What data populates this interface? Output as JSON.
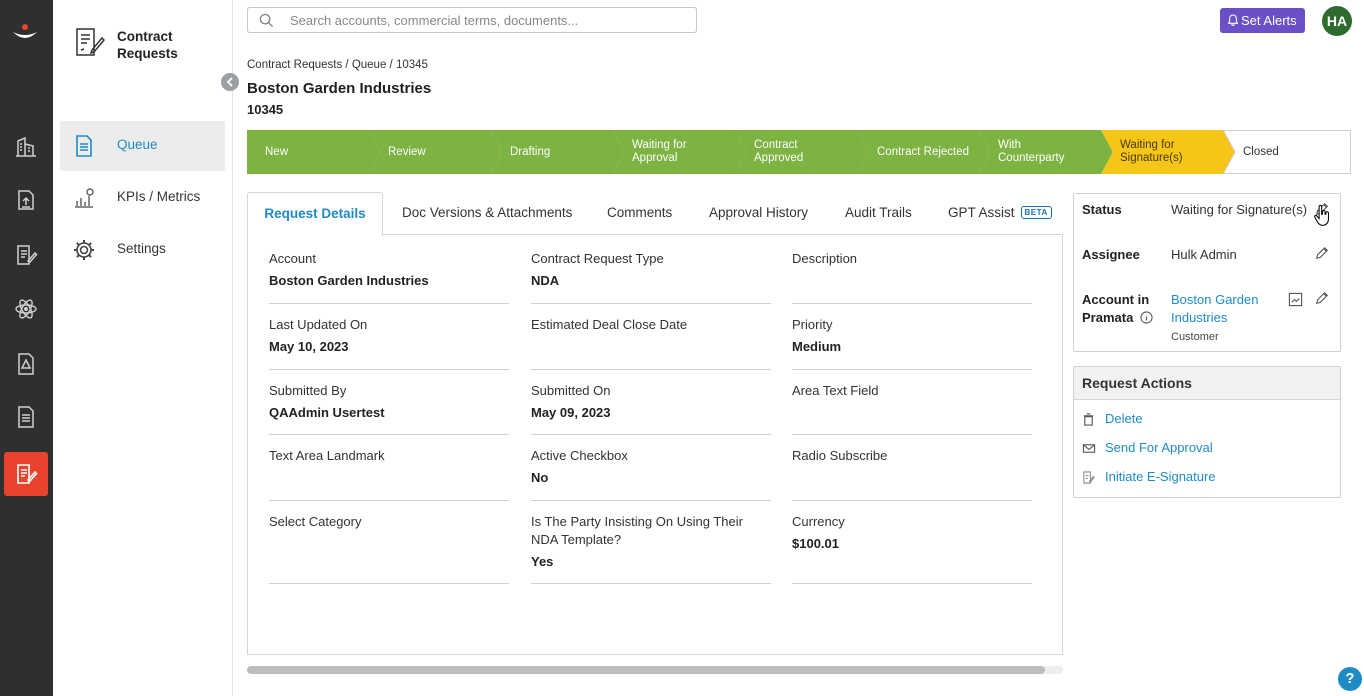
{
  "app": {
    "module_title": "Contract Requests"
  },
  "sidebar": {
    "items": [
      {
        "label": "Queue",
        "icon": "document-list-icon",
        "active": true
      },
      {
        "label": "KPIs / Metrics",
        "icon": "chart-icon",
        "active": false
      },
      {
        "label": "Settings",
        "icon": "gear-icon",
        "active": false
      }
    ]
  },
  "rail": {
    "icons": [
      "logo-icon",
      "building-icon",
      "upload-icon",
      "contract-edit-icon",
      "atom-icon",
      "document-warning-icon",
      "document-icon",
      "contract-requests-icon"
    ]
  },
  "search": {
    "placeholder": "Search accounts, commercial terms, documents..."
  },
  "topbar": {
    "alerts_label": "Set Alerts",
    "avatar_initials": "HA"
  },
  "breadcrumb": "Contract Requests / Queue / 10345",
  "page": {
    "title": "Boston Garden Industries",
    "id": "10345"
  },
  "stepper": {
    "steps": [
      {
        "label": "New",
        "state": "done"
      },
      {
        "label": "Review",
        "state": "done"
      },
      {
        "label": "Drafting",
        "state": "done"
      },
      {
        "label": "Waiting for Approval",
        "state": "done"
      },
      {
        "label": "Contract Approved",
        "state": "done"
      },
      {
        "label": "Contract Rejected",
        "state": "done"
      },
      {
        "label": "With Counterparty",
        "state": "done"
      },
      {
        "label": "Waiting for Signature(s)",
        "state": "current"
      },
      {
        "label": "Closed",
        "state": "pending"
      }
    ]
  },
  "tabs": [
    {
      "label": "Request Details",
      "active": true
    },
    {
      "label": "Doc Versions & Attachments"
    },
    {
      "label": "Comments"
    },
    {
      "label": "Approval History"
    },
    {
      "label": "Audit Trails"
    },
    {
      "label": "GPT Assist",
      "badge": "BETA"
    }
  ],
  "details": [
    {
      "label": "Account",
      "value": "Boston Garden Industries"
    },
    {
      "label": "Contract Request Type",
      "value": "NDA"
    },
    {
      "label": "Description",
      "value": ""
    },
    {
      "label": "Last Updated On",
      "value": "May 10, 2023"
    },
    {
      "label": "Estimated Deal Close Date",
      "value": ""
    },
    {
      "label": "Priority",
      "value": "Medium"
    },
    {
      "label": "Submitted By",
      "value": "QAAdmin Usertest"
    },
    {
      "label": "Submitted On",
      "value": "May 09, 2023"
    },
    {
      "label": "Area Text Field",
      "value": ""
    },
    {
      "label": "Text Area Landmark",
      "value": ""
    },
    {
      "label": "Active Checkbox",
      "value": "No"
    },
    {
      "label": "Radio Subscribe",
      "value": ""
    },
    {
      "label": "Select Category",
      "value": ""
    },
    {
      "label": "Is The Party Insisting On Using Their NDA Template?",
      "value": "Yes"
    },
    {
      "label": "Currency",
      "value": "$100.01"
    }
  ],
  "status_card": {
    "status_label": "Status",
    "status_value": "Waiting for Signature(s)",
    "assignee_label": "Assignee",
    "assignee_value": "Hulk Admin",
    "account_label_1": "Account in",
    "account_label_2": "Pramata",
    "account_value_1": "Boston Garden",
    "account_value_2": "Industries",
    "account_type": "Customer"
  },
  "request_actions": {
    "title": "Request Actions",
    "items": [
      {
        "label": "Delete",
        "icon": "trash-icon"
      },
      {
        "label": "Send For Approval",
        "icon": "envelope-icon"
      },
      {
        "label": "Initiate E-Signature",
        "icon": "signature-icon"
      }
    ]
  },
  "help": {
    "label": "?"
  },
  "colors": {
    "accent": "#1f8bc4",
    "step_done": "#7cb342",
    "step_current": "#f5c518",
    "brand": "#e8442d",
    "alerts": "#6a4fc6"
  }
}
